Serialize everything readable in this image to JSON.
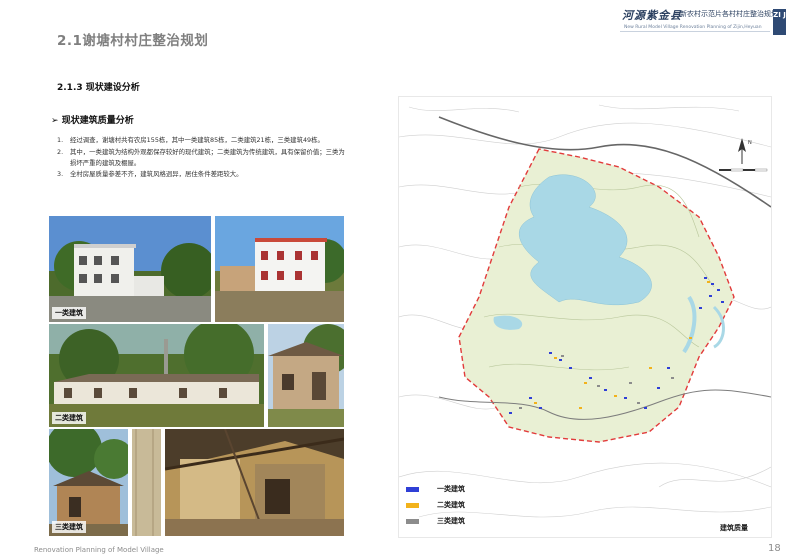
{
  "header": {
    "title": "2.1谢塘村村庄整治规划",
    "brand_calligraphy": "河源紫金县",
    "brand_name": "新农村示范片各村村庄整治规划",
    "brand_english": "New Rural Model Village Renovation Planning of Zijin,Heyuan",
    "brand_badge": "ZI J"
  },
  "section": {
    "heading": "2.1.3 现状建设分析",
    "subheading": "现状建筑质量分析",
    "subheading_marker": "➢"
  },
  "body": {
    "items": [
      {
        "num": "1.",
        "text": "经过调查，谢塘村共有农房155栋，其中一类建筑85栋，二类建筑21栋，三类建筑49栋。"
      },
      {
        "num": "2.",
        "text": "其中，一类建筑为结构外观都保存较好的现代建筑；二类建筑为传统建筑，具有保留价值；三类为损坏严重的建筑及棚屋。"
      },
      {
        "num": "3.",
        "text": "全村房屋质量参差不齐，建筑风格迥异，居住条件差距较大。"
      }
    ]
  },
  "photos": {
    "class1_label": "一类建筑",
    "class2_label": "二类建筑",
    "class3_label": "三类建筑"
  },
  "map": {
    "caption": "建筑质量",
    "north_label": "N",
    "legend": [
      {
        "label": "一类建筑",
        "color": "#2f3fd6"
      },
      {
        "label": "二类建筑",
        "color": "#f2b21b"
      },
      {
        "label": "三类建筑",
        "color": "#8c8c8c"
      }
    ]
  },
  "footer": {
    "left": "Renovation Planning of Model Village",
    "page": "18"
  },
  "colors": {
    "boundary": "#e23b3b",
    "vegetation": "#e9f0d4",
    "water": "#a9d8e6",
    "accent": "#2f4a74"
  }
}
